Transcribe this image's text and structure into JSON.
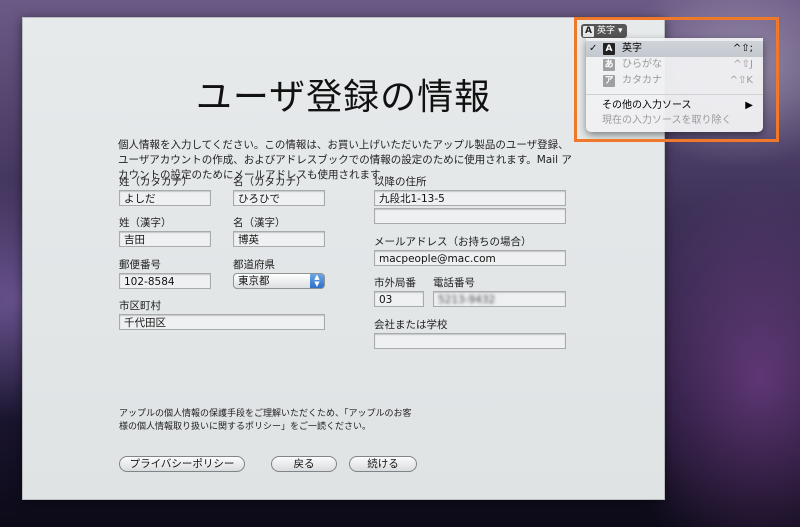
{
  "page": {
    "title": "ユーザ登録の情報",
    "intro": "個人情報を入力してください。この情報は、お買い上げいただいたアップル製品のユーザ登録、ユーザアカウントの作成、およびアドレスブックでの情報の設定のために使用されます。Mail アカウントの設定のためにメールアドレスも使用されます。"
  },
  "form": {
    "last_kana": {
      "label": "姓（カタカナ）",
      "value": "よしだ"
    },
    "first_kana": {
      "label": "名（カタカナ）",
      "value": "ひろひで"
    },
    "last_kanji": {
      "label": "姓（漢字）",
      "value": "吉田"
    },
    "first_kanji": {
      "label": "名（漢字）",
      "value": "博英"
    },
    "postal": {
      "label": "郵便番号",
      "value": "102-8584"
    },
    "prefecture": {
      "label": "都道府県",
      "value": "東京都"
    },
    "city": {
      "label": "市区町村",
      "value": "千代田区"
    },
    "address": {
      "label": "以降の住所",
      "value": "九段北1-13-5",
      "value2": ""
    },
    "email": {
      "label": "メールアドレス（お持ちの場合）",
      "value": "macpeople@mac.com"
    },
    "area_code": {
      "label": "市外局番",
      "value": "03"
    },
    "phone": {
      "label": "電話番号",
      "value": "5213-9432"
    },
    "company": {
      "label": "会社または学校",
      "value": ""
    }
  },
  "footnote": "アップルの個人情報の保護手段をご理解いただくため、「アップルのお客様の個人情報取り扱いに関するポリシー」をご一読ください。",
  "buttons": {
    "privacy": "プライバシーポリシー",
    "back": "戻る",
    "continue": "続ける"
  },
  "input_menu": {
    "badge_letter": "A",
    "badge_label": "英字",
    "items": [
      {
        "check": "✓",
        "icon_text": "A",
        "label": "英字",
        "shortcut": "^⇧;"
      },
      {
        "check": "",
        "icon_text": "あ",
        "label": "ひらがな",
        "shortcut": "^⇧J"
      },
      {
        "check": "",
        "icon_text": "ア",
        "label": "カタカナ",
        "shortcut": "^⇧K"
      }
    ],
    "other_sources": "その他の入力ソース",
    "other_arrow": "▶",
    "remove_source": "現在の入力ソースを取り除く"
  },
  "colors": {
    "highlight": "#f0782a",
    "accent": "#2f70c9"
  }
}
